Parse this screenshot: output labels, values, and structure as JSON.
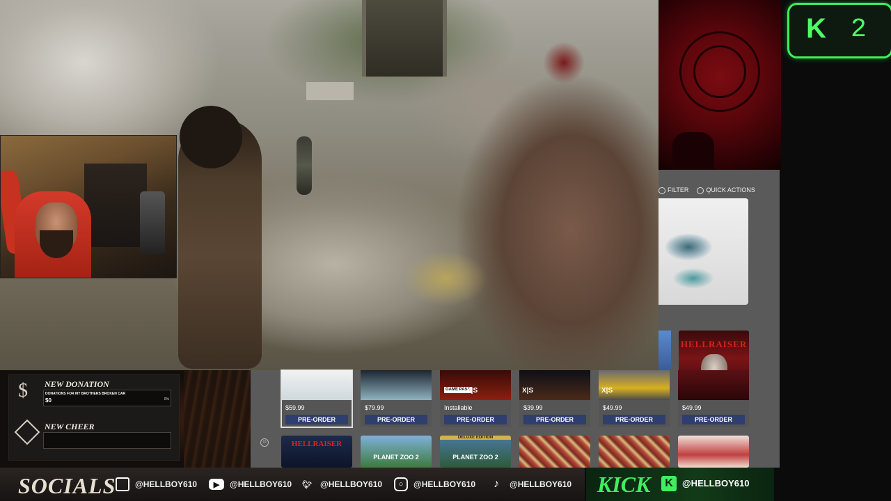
{
  "overlay": {
    "kick_badge": {
      "logo": "K",
      "count": "2"
    }
  },
  "store": {
    "filter_label": "FILTER",
    "quick_actions_label": "QUICK ACTIONS",
    "hellraiser_title": "HELLRAISER",
    "tiles": [
      {
        "price": "$59.99",
        "button": "PRE-ORDER"
      },
      {
        "price": "$79.99",
        "button": "PRE-ORDER"
      },
      {
        "price": "Installable",
        "button": "PRE-ORDER",
        "badge": "GAME PASS",
        "platform": "X|S"
      },
      {
        "price": "$39.99",
        "button": "PRE-ORDER",
        "platform": "X|S"
      },
      {
        "price": "$49.99",
        "button": "PRE-ORDER",
        "platform": "X|S"
      },
      {
        "price": "$49.99",
        "button": "PRE-ORDER"
      }
    ],
    "row2": [
      {
        "text": "HELLRAISER"
      },
      {
        "text": "PLANET ZOO 2"
      },
      {
        "text": "PLANET ZOO 2",
        "tag": "DELUXE EDITION"
      },
      {
        "text": ""
      },
      {
        "text": ""
      },
      {
        "text": ""
      }
    ]
  },
  "alerts": {
    "donation": {
      "icon": "$",
      "title": "NEW DONATION",
      "goal_text": "DONATIONS FOR MY BROTHERS BROKEN CAR",
      "amount": "$0",
      "percent": "0%",
      "progress": 0
    },
    "cheer": {
      "title": "NEW CHEER"
    }
  },
  "socials": {
    "title": "SOCIALS",
    "items": [
      {
        "platform": "twitch-icon",
        "handle": "@HELLBOY610",
        "color": "#ffffff"
      },
      {
        "platform": "youtube-icon",
        "handle": "@HELLBOY610",
        "color": "#ffffff"
      },
      {
        "platform": "twitter-icon",
        "handle": "@HELLBOY610",
        "color": "#ffffff"
      },
      {
        "platform": "instagram-icon",
        "handle": "@HELLBOY610",
        "color": "#ffffff"
      },
      {
        "platform": "tiktok-icon",
        "handle": "@HELLBOY610",
        "color": "#ffffff"
      }
    ],
    "kick": {
      "word": "KICK",
      "logo": "K",
      "handle": "@HELLBOY610"
    }
  },
  "colors": {
    "kick_green": "#42ee61",
    "preorder_blue": "#2e3e6e",
    "hell_red": "#7a0c12"
  }
}
